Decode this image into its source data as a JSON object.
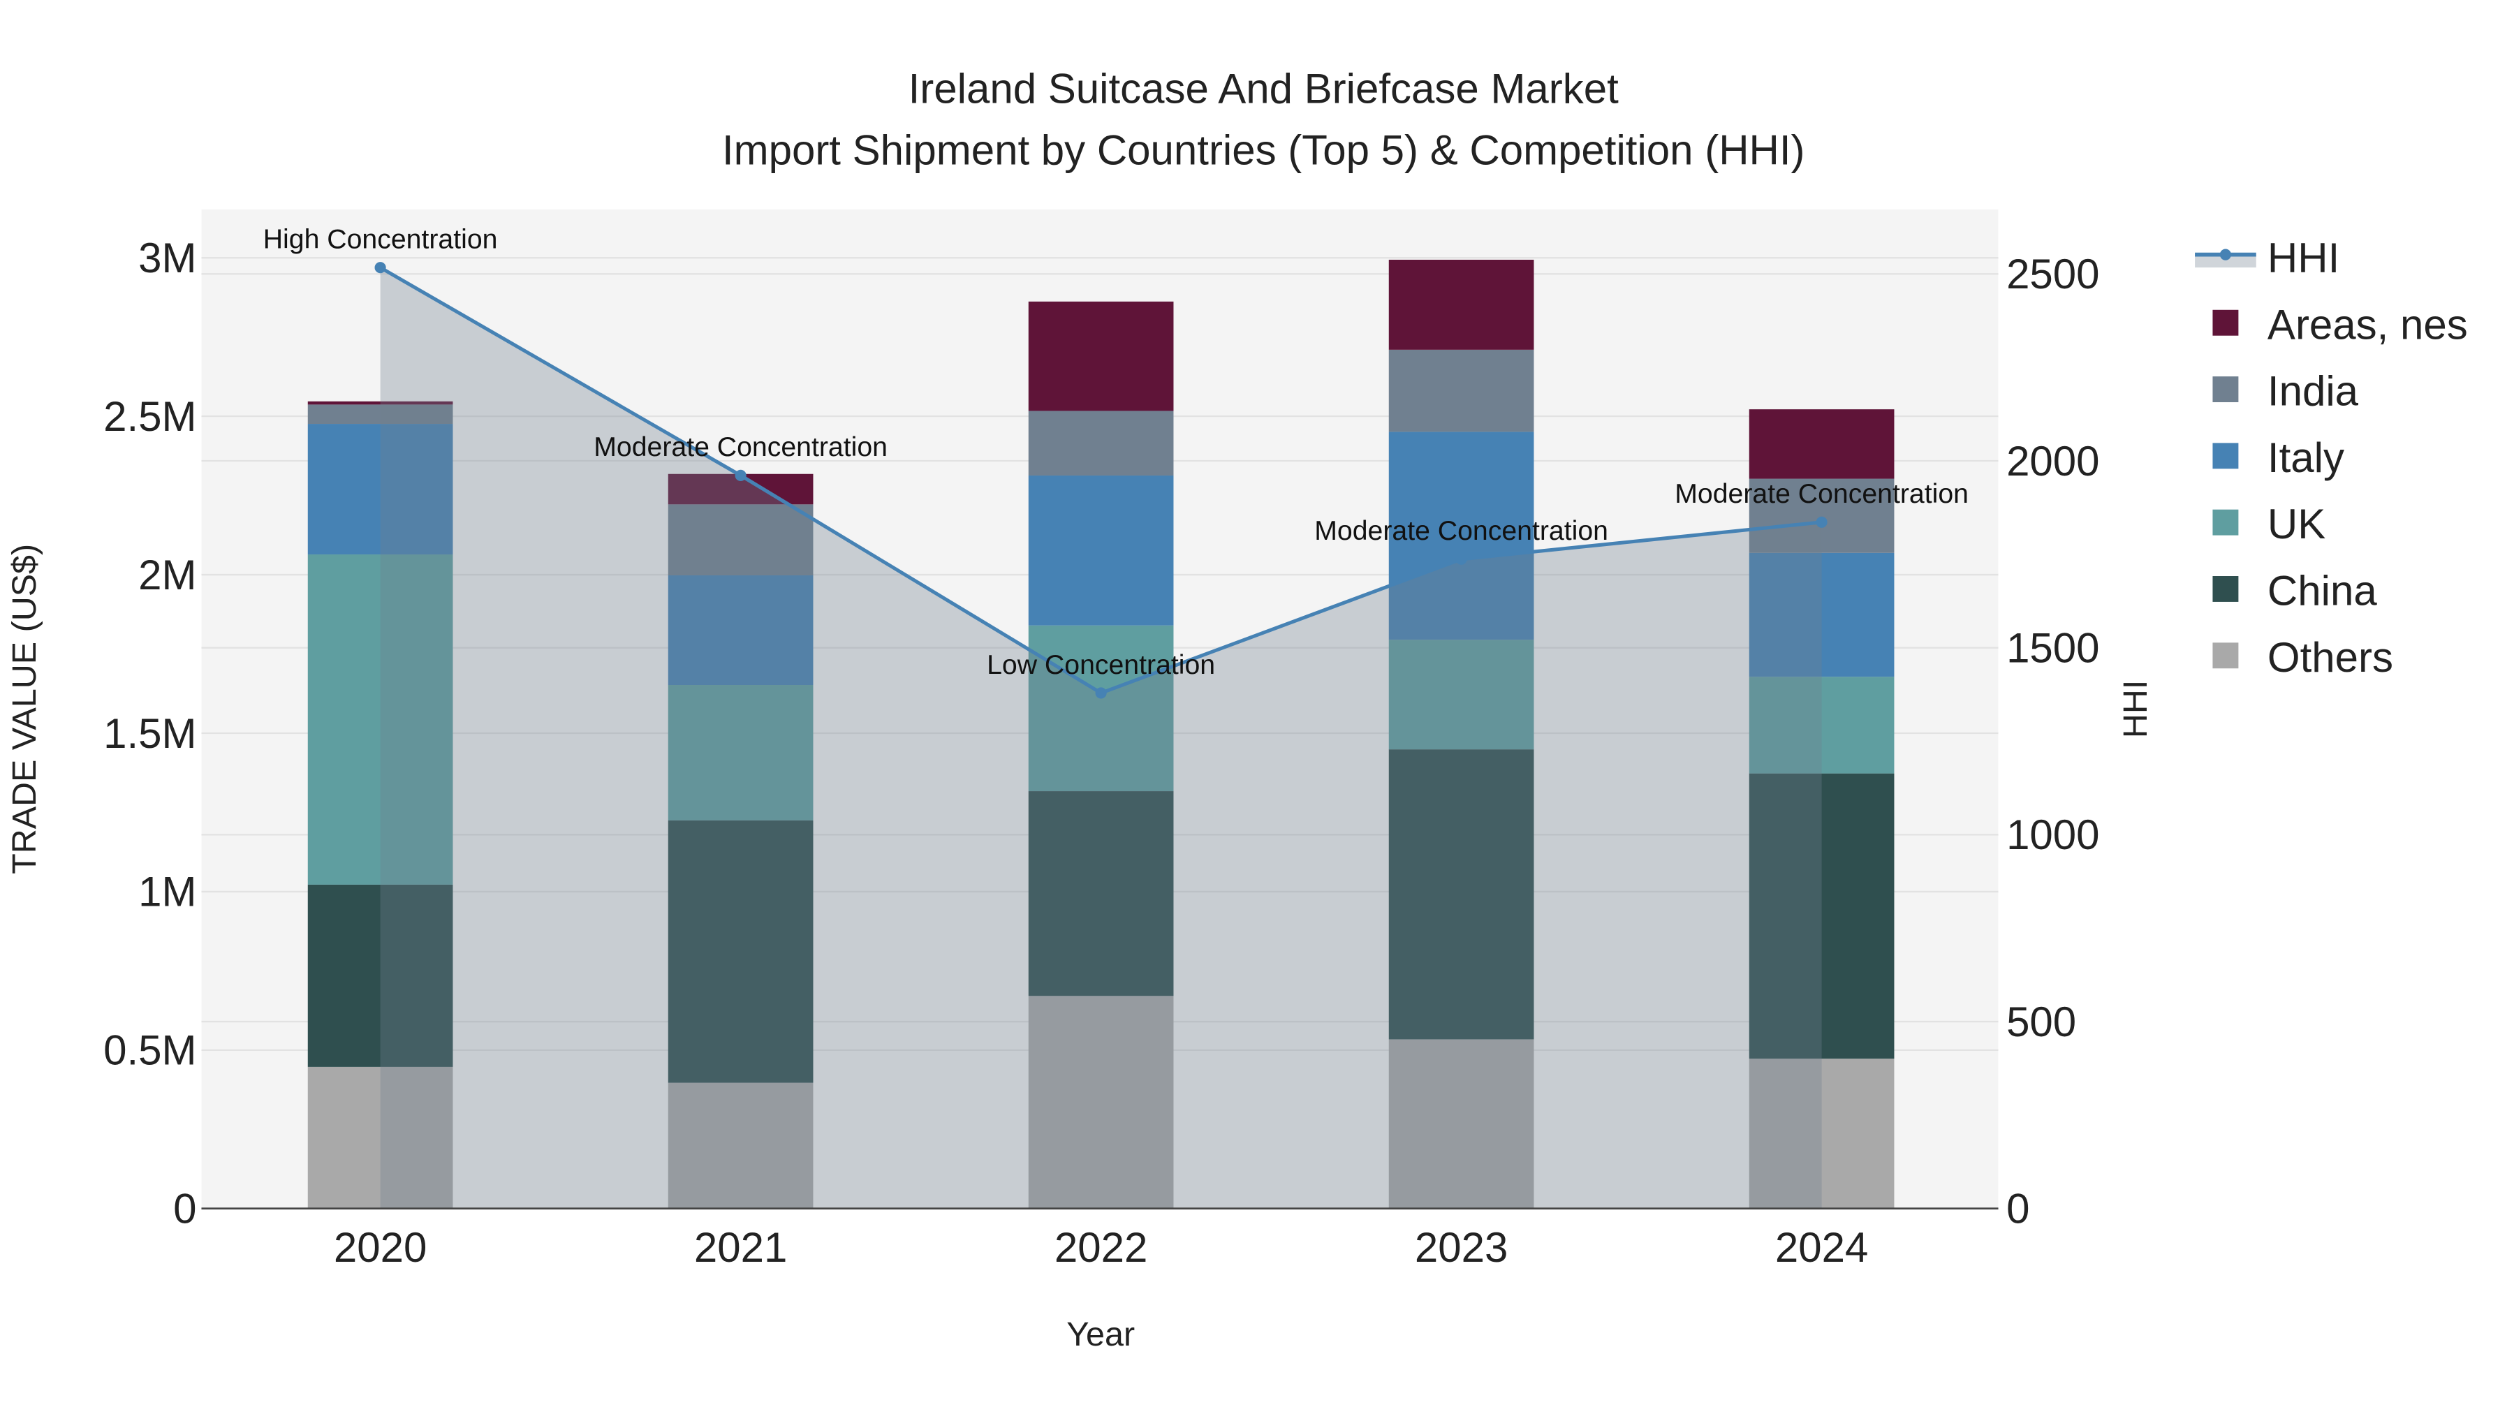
{
  "chart_data": {
    "type": "bar",
    "title_line1": "Ireland Suitcase And Briefcase Market",
    "title_line2": "Import Shipment by Countries (Top 5) & Competition (HHI)",
    "xlabel": "Year",
    "ylabel": "TRADE VALUE (US$)",
    "y2label": "HHI",
    "categories": [
      "2020",
      "2021",
      "2022",
      "2023",
      "2024"
    ],
    "ylim": [
      0,
      3150000
    ],
    "y2lim": [
      0,
      2640
    ],
    "yticks": [
      0,
      500000,
      1000000,
      1500000,
      2000000,
      2500000,
      3000000
    ],
    "ytick_labels": [
      "0",
      "0.5M",
      "1M",
      "1.5M",
      "2M",
      "2.5M",
      "3M"
    ],
    "y2ticks": [
      0,
      500,
      1000,
      1500,
      2000,
      2500
    ],
    "y2tick_labels": [
      "0",
      "500",
      "1000",
      "1500",
      "2000",
      "2500"
    ],
    "stacked": true,
    "series": [
      {
        "name": "Others",
        "color": "#a9a9a9",
        "values": [
          447000,
          397000,
          671000,
          534000,
          473000
        ]
      },
      {
        "name": "China",
        "color": "#2f4f4f",
        "values": [
          575000,
          828000,
          646000,
          915000,
          900000
        ]
      },
      {
        "name": "UK",
        "color": "#5f9ea0",
        "values": [
          1042000,
          427000,
          523000,
          346000,
          305000
        ]
      },
      {
        "name": "Italy",
        "color": "#4682b4",
        "values": [
          412000,
          346000,
          473000,
          656000,
          391000
        ]
      },
      {
        "name": "India",
        "color": "#708090",
        "values": [
          61000,
          224000,
          204000,
          259000,
          234000
        ]
      },
      {
        "name": "Areas, nes",
        "color": "#5f1438",
        "values": [
          10000,
          96000,
          345000,
          284000,
          219000
        ]
      }
    ],
    "line_series": {
      "name": "HHI",
      "color": "#4682b4",
      "values": [
        2517,
        1961,
        1379,
        1737,
        1836
      ],
      "annotations": [
        "High Concentration",
        "Moderate Concentration",
        "Low Concentration",
        "Moderate Concentration",
        "Moderate Concentration"
      ]
    },
    "legend_order": [
      "HHI",
      "Areas, nes",
      "India",
      "Italy",
      "UK",
      "China",
      "Others"
    ],
    "legend_position": "right",
    "grid": true
  }
}
